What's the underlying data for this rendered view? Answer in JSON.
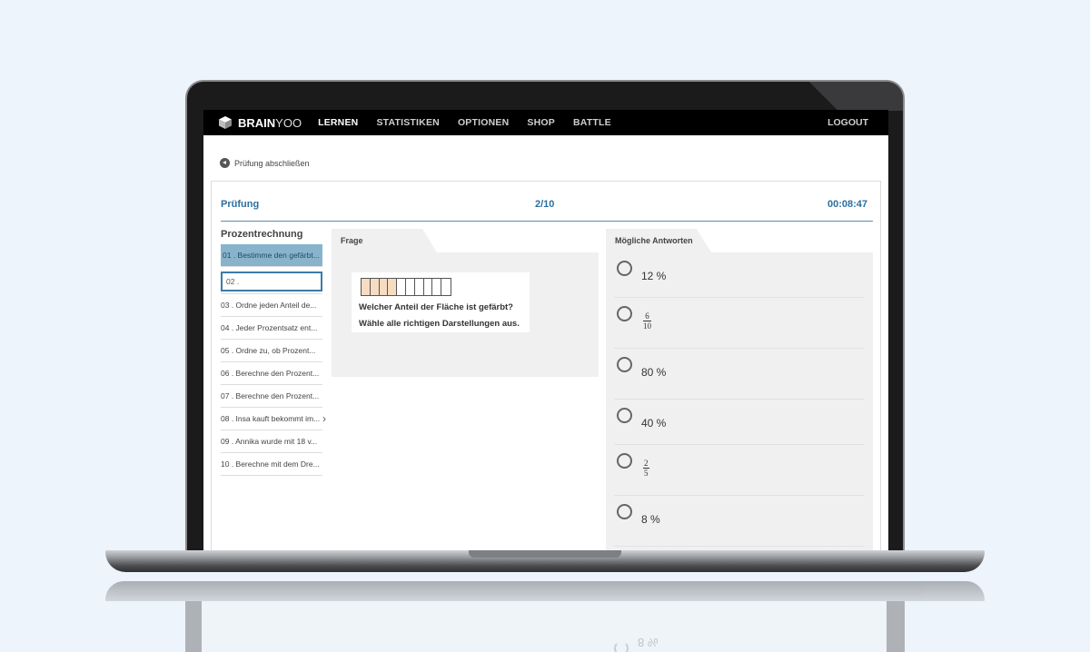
{
  "nav": {
    "brand_bold": "BRAIN",
    "brand_thin": "YOO",
    "items": [
      "LERNEN",
      "STATISTIKEN",
      "OPTIONEN",
      "SHOP",
      "BATTLE"
    ],
    "logout": "LOGOUT"
  },
  "back_link": "Prüfung abschließen",
  "exam": {
    "title": "Prüfung",
    "progress": "2/10",
    "timer": "00:08:47"
  },
  "question_list": {
    "topic": "Prozentrechnung",
    "items": [
      "01 . Bestimme den gefärbt...",
      "02 .",
      "03 . Ordne jeden Anteil de...",
      "04 . Jeder Prozentsatz ent...",
      "05 . Ordne zu, ob Prozent...",
      "06 . Berechne den Prozent...",
      "07 . Berechne den Prozent...",
      "08 . Insa kauft bekommt im...",
      "09 . Annika wurde mit 18 v...",
      "10 . Berechne mit dem Dre..."
    ]
  },
  "question": {
    "tab": "Frage",
    "grid": {
      "cells": 10,
      "filled": 4,
      "filled_color": "#f6dcc0"
    },
    "line1": "Welcher Anteil der Fläche ist gefärbt?",
    "line2": "Wähle alle richtigen Darstellungen aus."
  },
  "answers": {
    "tab": "Mögliche Antworten",
    "options": [
      {
        "text": "12 %"
      },
      {
        "num": "6",
        "den": "10"
      },
      {
        "text": "80 %"
      },
      {
        "text": "40 %"
      },
      {
        "num": "2",
        "den": "5"
      },
      {
        "text": "8 %"
      }
    ],
    "reflection_text": "8 %"
  },
  "colors": {
    "accent": "#2b6f9f",
    "active_item": "#87b4cc",
    "navbar": "#000000",
    "panel_bg": "#f0f0f0"
  }
}
